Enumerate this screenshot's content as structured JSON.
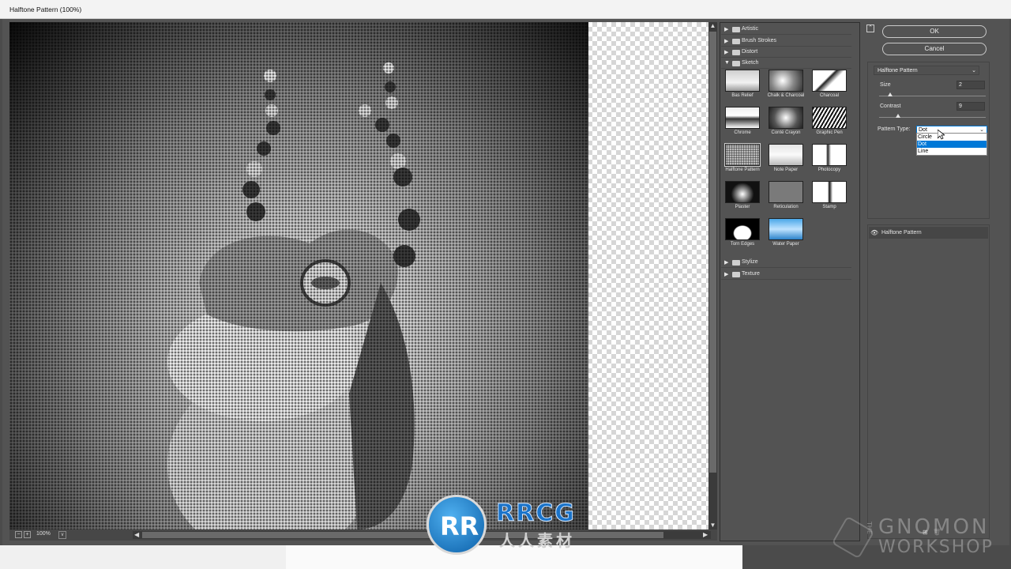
{
  "window": {
    "title": "Halftone Pattern (100%)"
  },
  "preview": {
    "zoom": "100%",
    "minus": "−",
    "plus": "+"
  },
  "gallery": {
    "folders_top": [
      "Artistic",
      "Brush Strokes",
      "Distort"
    ],
    "open_folder": "Sketch",
    "thumbnails": [
      "Bas Relief",
      "Chalk & Charcoal",
      "Charcoal",
      "Chrome",
      "Conté Crayon",
      "Graphic Pen",
      "Halftone Pattern",
      "Note Paper",
      "Photocopy",
      "Plaster",
      "Reticulation",
      "Stamp",
      "Torn Edges",
      "Water Paper"
    ],
    "selected": "Halftone Pattern",
    "folders_bottom": [
      "Stylize",
      "Texture"
    ]
  },
  "settings": {
    "ok_label": "OK",
    "cancel_label": "Cancel",
    "filter_select": "Halftone Pattern",
    "size_label": "Size",
    "size_value": "2",
    "size_fraction": 0.1,
    "contrast_label": "Contrast",
    "contrast_value": "9",
    "contrast_fraction": 0.18,
    "pattern_type_label": "Pattern Type:",
    "pattern_type_value": "Dot",
    "pattern_type_options": [
      "Circle",
      "Dot",
      "Line"
    ],
    "pattern_type_highlighted": "Dot"
  },
  "layers": {
    "items": [
      "Halftone Pattern"
    ]
  },
  "watermarks": {
    "rrcg_logo": "RR",
    "rrcg_text": "RRCG",
    "rrcg_cn": "人人素材",
    "gnomon_the": "THE",
    "gnomon_line1": "GNOMON",
    "gnomon_line2": "WORKSHOP"
  },
  "colors": {
    "dialog_bg": "#535353",
    "selection_blue": "#0078d7",
    "titlebar": "#f3f3f3"
  }
}
